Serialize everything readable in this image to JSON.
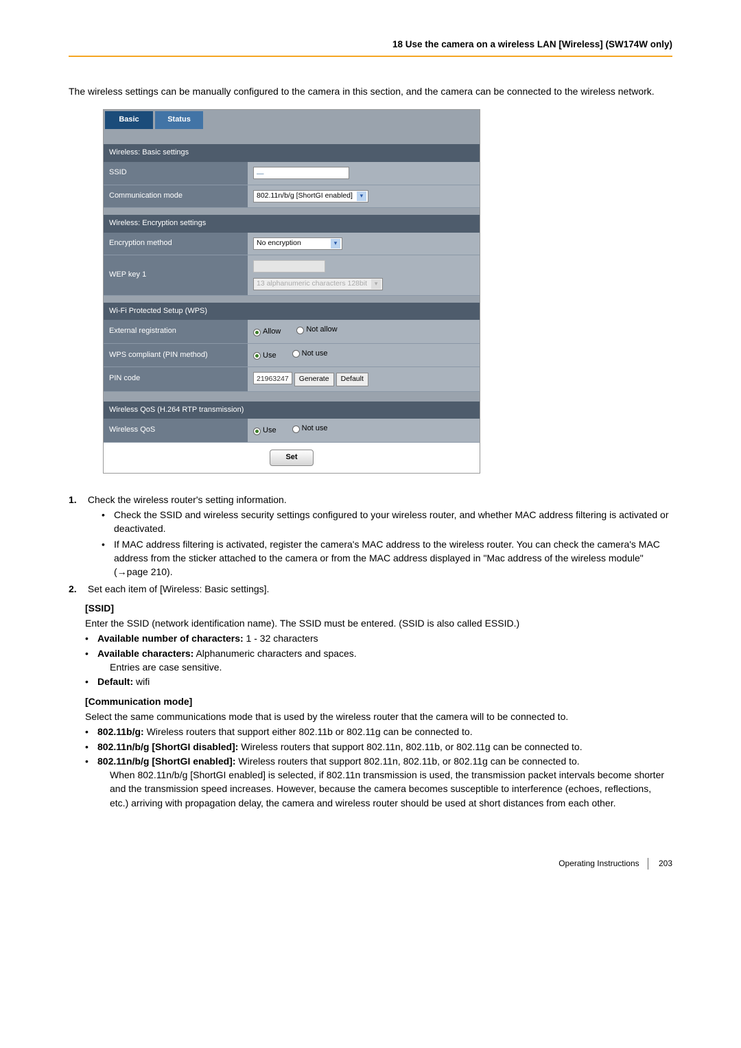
{
  "header": "18 Use the camera on a wireless LAN [Wireless] (SW174W only)",
  "intro": "The wireless settings can be manually configured to the camera in this section, and the camera can be connected to the wireless network.",
  "tabs": {
    "basic": "Basic",
    "status": "Status"
  },
  "panel": {
    "basicSettings": {
      "title": "Wireless: Basic settings",
      "ssidLabel": "SSID",
      "commLabel": "Communication mode",
      "commOption": "802.11n/b/g [ShortGI enabled]"
    },
    "encryption": {
      "title": "Wireless: Encryption settings",
      "methodLabel": "Encryption method",
      "methodOption": "No encryption",
      "wepLabel": "WEP key 1",
      "wepOption": "13 alphanumeric characters 128bit"
    },
    "wps": {
      "title": "Wi-Fi Protected Setup (WPS)",
      "extRegLabel": "External registration",
      "allow": "Allow",
      "notAllow": "Not allow",
      "wpsPinLabel": "WPS compliant (PIN method)",
      "use": "Use",
      "notUse": "Not use",
      "pinLabel": "PIN code",
      "pinValue": "21963247",
      "generate": "Generate",
      "default": "Default"
    },
    "qos": {
      "title": "Wireless QoS (H.264 RTP transmission)",
      "label": "Wireless QoS",
      "use": "Use",
      "notUse": "Not use"
    },
    "set": "Set"
  },
  "steps": {
    "s1": "Check the wireless router's setting information.",
    "s1a": "Check the SSID and wireless security settings configured to your wireless router, and whether MAC address filtering is activated or deactivated.",
    "s1b": "If MAC address filtering is activated, register the camera's MAC address to the wireless router. You can check the camera's MAC address from the sticker attached to the camera or from the MAC address displayed in \"Mac address of the wireless module\" (→page 210).",
    "s2": "Set each item of [Wireless: Basic settings]."
  },
  "ssidSection": {
    "heading": "[SSID]",
    "desc": "Enter the SSID (network identification name). The SSID must be entered. (SSID is also called ESSID.)",
    "b1bold": "Available number of characters:",
    "b1rest": " 1 - 32 characters",
    "b2bold": "Available characters:",
    "b2rest": " Alphanumeric characters and spaces.",
    "b2line2": "Entries are case sensitive.",
    "b3bold": "Default:",
    "b3rest": " wifi"
  },
  "commSection": {
    "heading": "[Communication mode]",
    "desc": "Select the same communications mode that is used by the wireless router that the camera will to be connected to.",
    "b1bold": "802.11b/g:",
    "b1rest": " Wireless routers that support either 802.11b or 802.11g can be connected to.",
    "b2bold": "802.11n/b/g [ShortGI disabled]:",
    "b2rest": " Wireless routers that support 802.11n, 802.11b, or 802.11g can be connected to.",
    "b3bold": "802.11n/b/g [ShortGI enabled]:",
    "b3rest": " Wireless routers that support 802.11n, 802.11b, or 802.11g can be connected to.",
    "b3line2": "When 802.11n/b/g [ShortGI enabled] is selected, if 802.11n transmission is used, the transmission packet intervals become shorter and the transmission speed increases. However, because the camera becomes susceptible to interference (echoes, reflections, etc.) arriving with propagation delay, the camera and wireless router should be used at short distances from each other."
  },
  "footer": {
    "guide": "Operating Instructions",
    "page": "203"
  }
}
